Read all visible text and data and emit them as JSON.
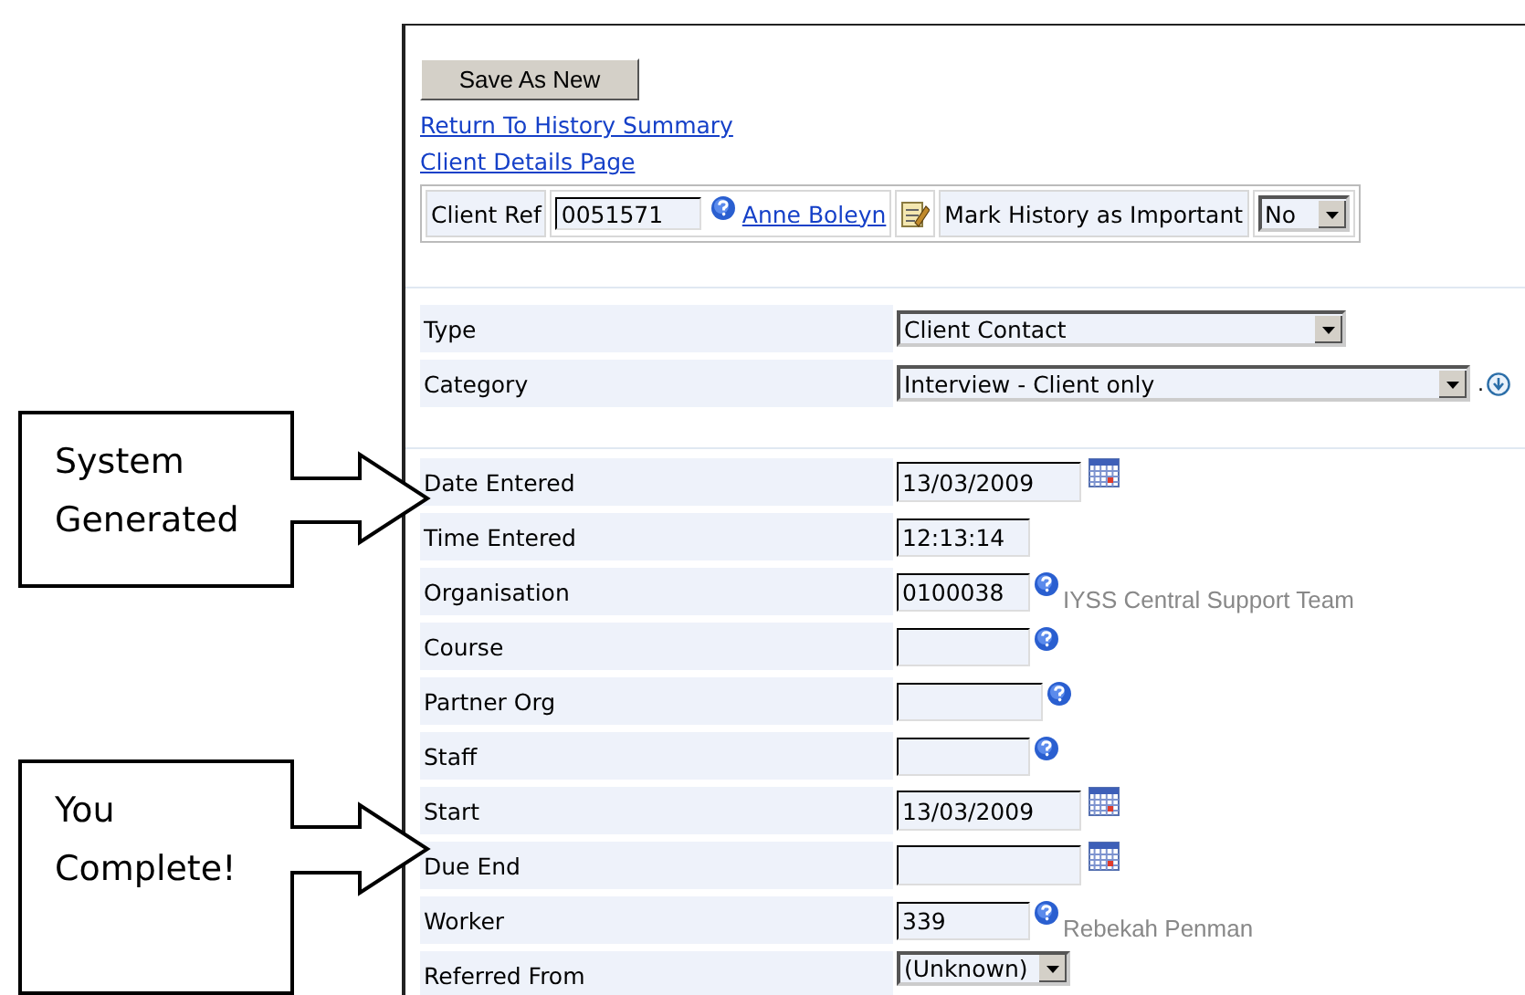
{
  "callouts": [
    {
      "text": "System Generated"
    },
    {
      "text": "You Complete!"
    }
  ],
  "save_button": "Save As New",
  "links": [
    "Return To History Summary",
    "Client Details Page"
  ],
  "client_bar": {
    "client_ref_label": "Client Ref",
    "client_ref": "0051571",
    "client_name": "Anne Boleyn",
    "important_label": "Mark History as Important",
    "important_value": "No"
  },
  "sections": [
    {
      "rows": [
        {
          "label": "Type",
          "kind": "combo",
          "value": "Client Contact"
        },
        {
          "label": "Category",
          "kind": "long-combo",
          "value": "Interview - Client only",
          "suffix": ".",
          "refresh": true
        }
      ]
    },
    {
      "rows": [
        {
          "label": "Date Entered",
          "kind": "date",
          "value": "13/03/2009",
          "calendar": true
        },
        {
          "label": "Time Entered",
          "kind": "code",
          "value": "12:13:14"
        },
        {
          "label": "Organisation",
          "kind": "code",
          "value": "0100038",
          "help": true,
          "note": "IYSS Central Support Team"
        },
        {
          "label": "Course",
          "kind": "code",
          "help": true
        },
        {
          "label": "Partner Org",
          "kind": "code-wide",
          "help": true
        },
        {
          "label": "Staff",
          "kind": "code",
          "help": true
        },
        {
          "label": "Start",
          "kind": "date",
          "value": "13/03/2009",
          "calendar": true
        },
        {
          "label": "Due End",
          "kind": "date",
          "calendar": true
        },
        {
          "label": "Worker",
          "kind": "code",
          "value": "339",
          "help": true,
          "note": "Rebekah Penman"
        },
        {
          "label": "Referred From",
          "kind": "dropdown",
          "value": "(Unknown)"
        }
      ]
    }
  ]
}
